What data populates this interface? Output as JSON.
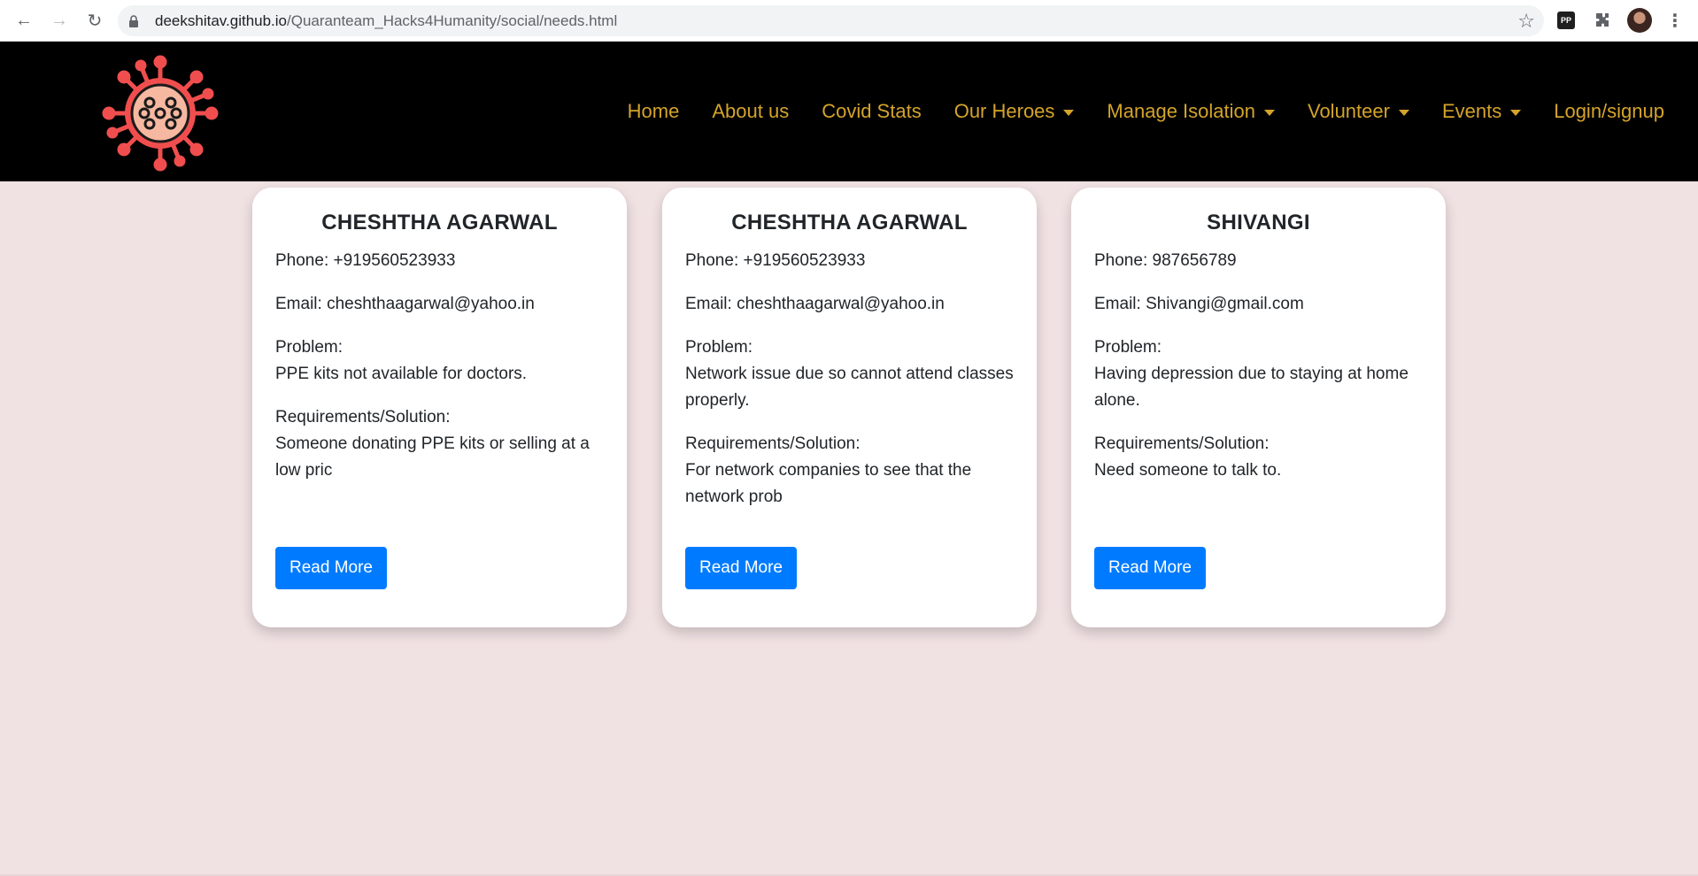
{
  "browser": {
    "url_host": "deekshitav.github.io",
    "url_path": "/Quaranteam_Hacks4Humanity/social/needs.html",
    "extension_pp": "PP"
  },
  "nav": {
    "items": [
      {
        "label": "Home",
        "dropdown": false
      },
      {
        "label": "About us",
        "dropdown": false
      },
      {
        "label": "Covid Stats",
        "dropdown": false
      },
      {
        "label": "Our Heroes",
        "dropdown": true
      },
      {
        "label": "Manage Isolation",
        "dropdown": true
      },
      {
        "label": "Volunteer",
        "dropdown": true
      },
      {
        "label": "Events",
        "dropdown": true
      },
      {
        "label": "Login/signup",
        "dropdown": false
      }
    ]
  },
  "cards": [
    {
      "name": "CHESHTHA AGARWAL",
      "phone": "Phone: +919560523933",
      "email": "Email: cheshthaagarwal@yahoo.in",
      "problem_label": "Problem:",
      "problem": "PPE kits not available for doctors.",
      "req_label": "Requirements/Solution:",
      "req": "Someone donating PPE kits or selling at a low pric",
      "button": "Read More"
    },
    {
      "name": "CHESHTHA AGARWAL",
      "phone": "Phone: +919560523933",
      "email": "Email: cheshthaagarwal@yahoo.in",
      "problem_label": "Problem:",
      "problem": "Network issue due so cannot attend classes properly.",
      "req_label": "Requirements/Solution:",
      "req": "For network companies to see that the network prob",
      "button": "Read More"
    },
    {
      "name": "SHIVANGI",
      "phone": "Phone: 987656789",
      "email": "Email: Shivangi@gmail.com",
      "problem_label": "Problem:",
      "problem": "Having depression due to staying at home alone.",
      "req_label": "Requirements/Solution:",
      "req": "Need someone to talk to.",
      "button": "Read More"
    }
  ],
  "colors": {
    "page_bg": "#f0e1e2",
    "navbar_bg": "#000000",
    "nav_link": "#d4a42a",
    "button": "#007bff",
    "logo": "#f04e4e"
  }
}
